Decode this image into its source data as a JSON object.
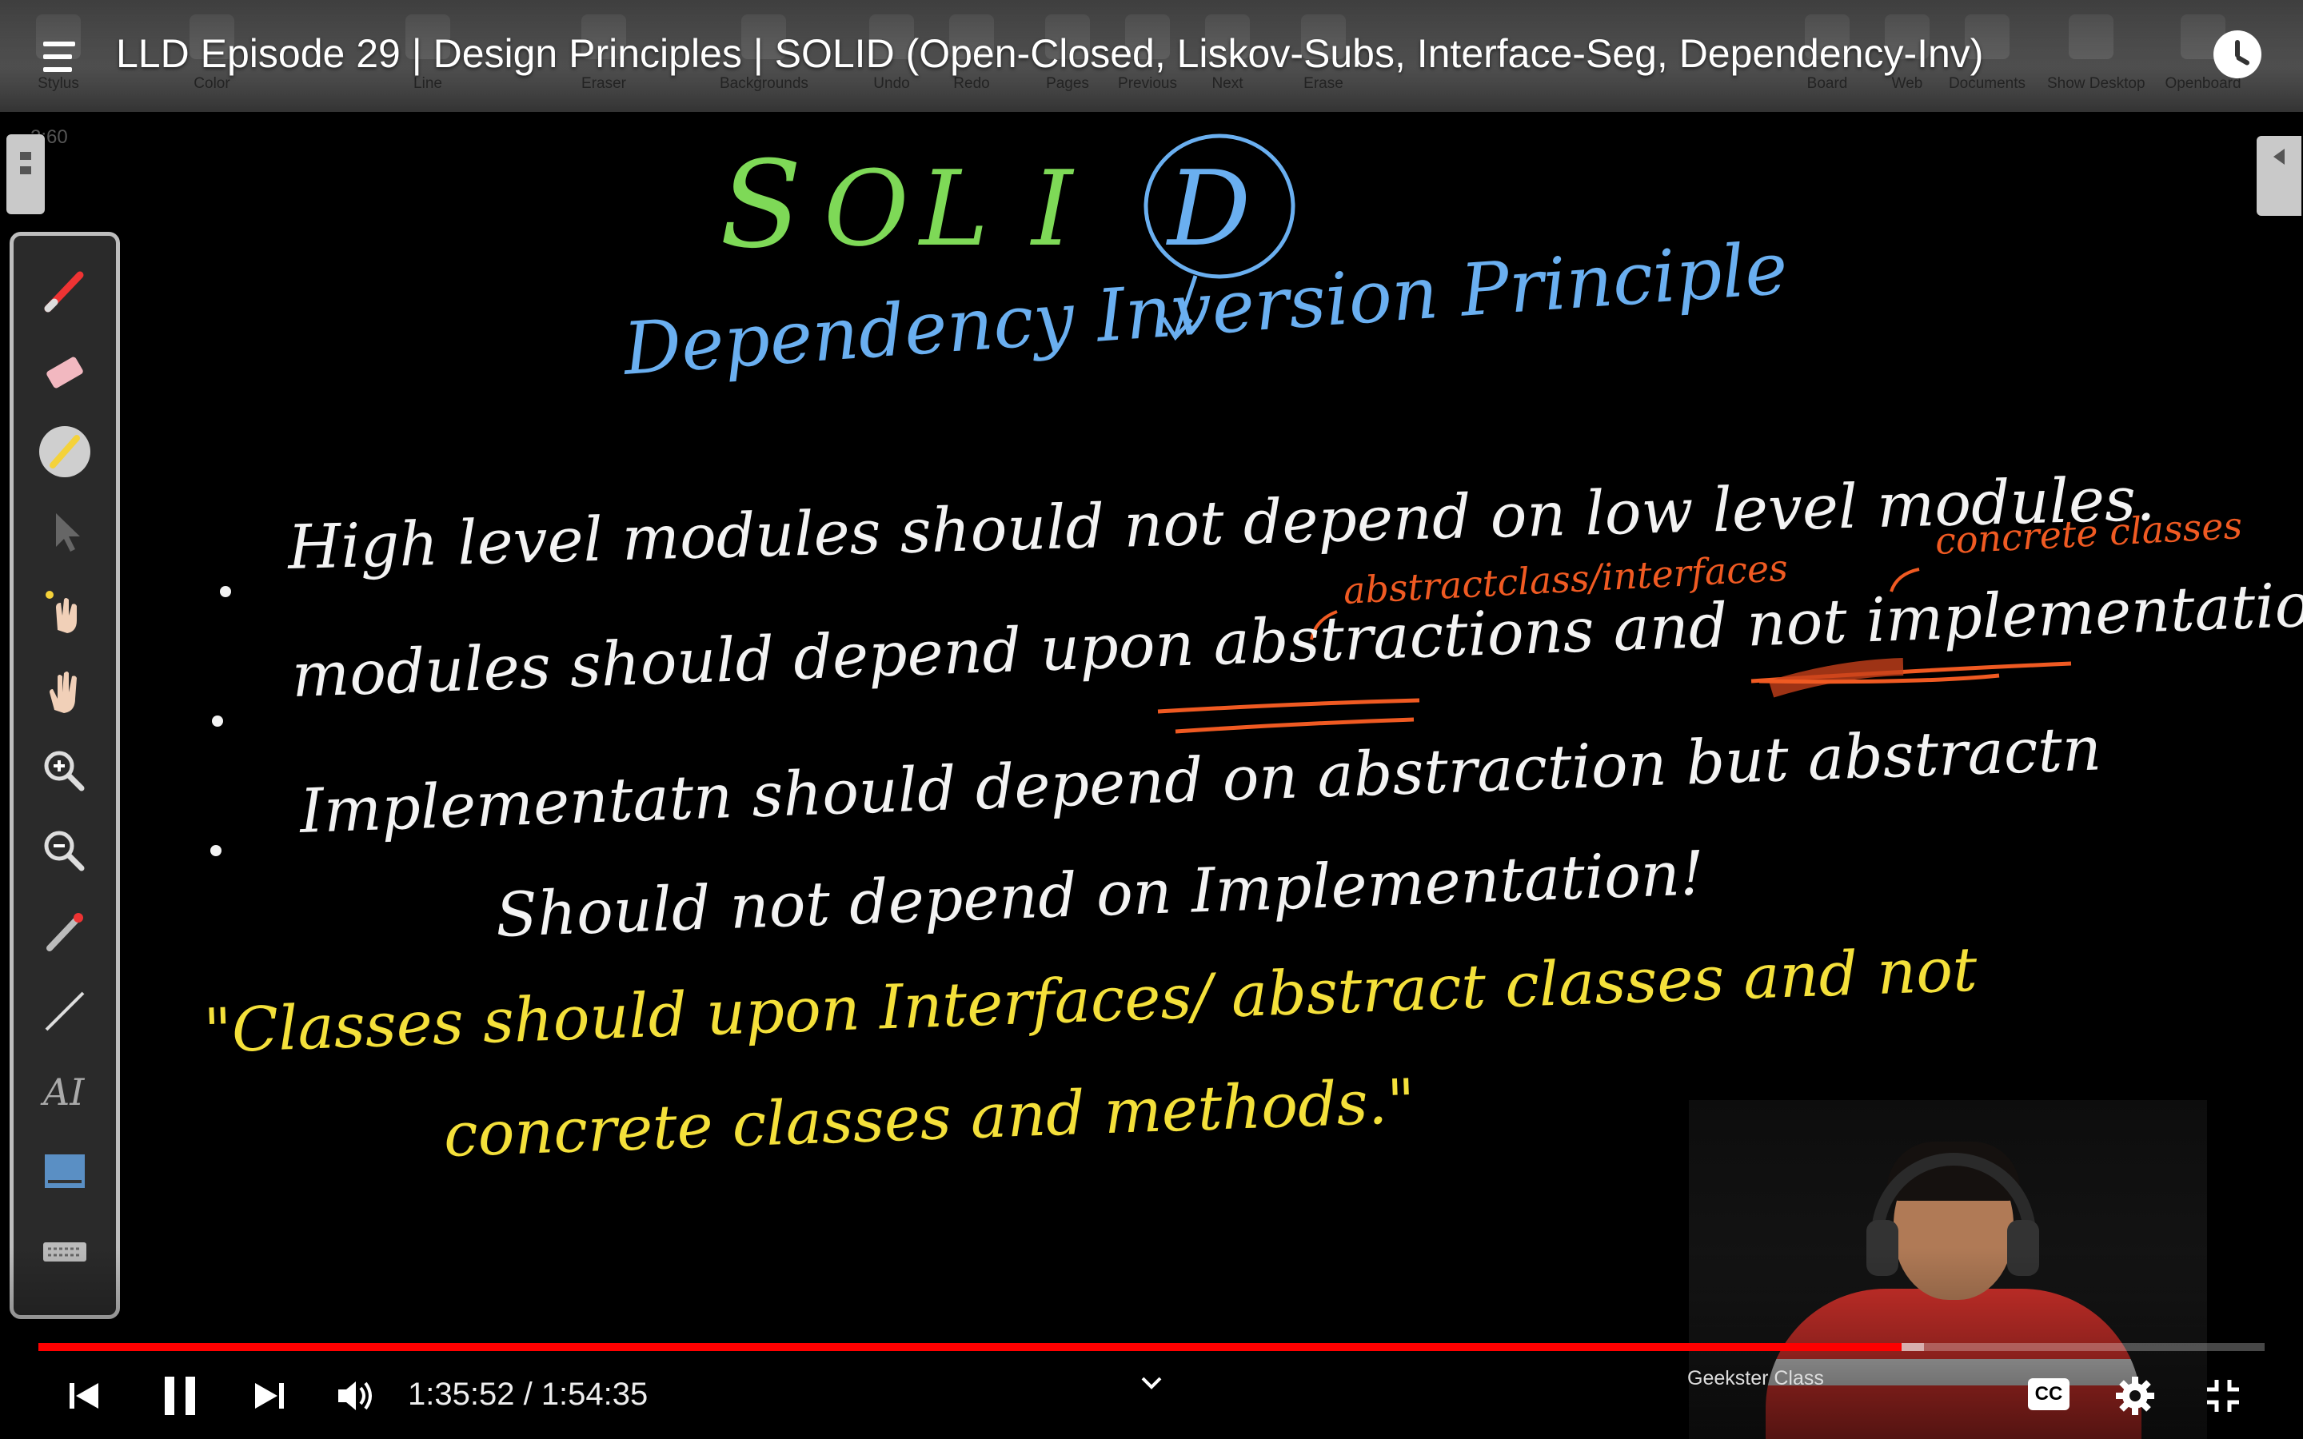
{
  "video": {
    "title": "LLD Episode 29 | Design Principles | SOLID (Open-Closed, Liskov-Subs, Interface-Seg, Dependency-Inv)",
    "current_time": "1:35:52",
    "separator": " / ",
    "duration": "1:54:35",
    "progress_played": 0.837,
    "progress_buffered": 0.847,
    "cc_label": "CC"
  },
  "openboard": {
    "toolbar_items": [
      "Stylus",
      "Color",
      "Line",
      "Eraser",
      "Backgrounds",
      "Undo",
      "Redo",
      "Pages",
      "Previous",
      "Next",
      "Erase",
      "Board",
      "Web",
      "Documents",
      "Show Desktop",
      "Openboard"
    ],
    "page_time": "2:60"
  },
  "board": {
    "solid_letters": [
      "S",
      "O",
      "L",
      "I",
      "D"
    ],
    "principle_title": "Dependency Inversion Principle",
    "bullets": [
      "High level modules should not depend on low level modules.",
      "modules should depend upon abstractions and not implementation.",
      "Implementatn should depend on abstraction but abstractn"
    ],
    "bullet3_cont": "Should not depend on Implementation!",
    "annotation_abstract": "abstractclass/interfaces",
    "annotation_concrete": "concrete classes",
    "quote_line1": "\"Classes should upon Interfaces/ abstract classes and not",
    "quote_line2": "concrete classes and methods.\""
  },
  "webcam": {
    "label": "Geekster Class"
  },
  "colors": {
    "green": "#7ed957",
    "blue": "#6aaff0",
    "orange": "#f05a22",
    "yellow": "#f4e03a",
    "progress_red": "#ff0000"
  },
  "icons": {
    "menu": "menu-icon",
    "clock": "clock-icon",
    "prev": "previous-icon",
    "pause": "pause-icon",
    "next": "next-icon",
    "volume": "volume-icon",
    "chevron": "chevron-down-icon",
    "settings": "settings-icon",
    "exit_fullscreen": "exit-fullscreen-icon"
  }
}
